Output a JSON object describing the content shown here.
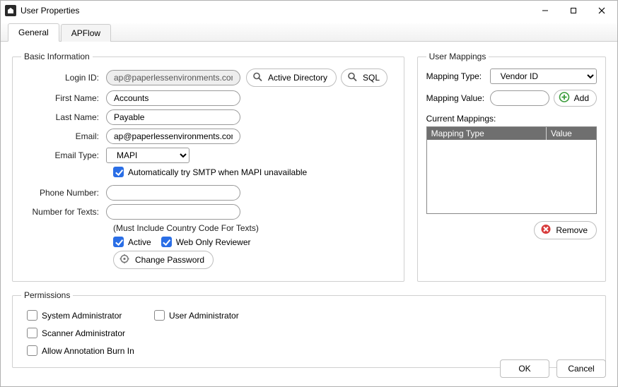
{
  "window": {
    "title": "User Properties"
  },
  "tabs": {
    "general": "General",
    "apflow": "APFlow"
  },
  "basic": {
    "legend": "Basic Information",
    "labels": {
      "login": "Login ID:",
      "first": "First Name:",
      "last": "Last Name:",
      "email": "Email:",
      "emailType": "Email Type:",
      "phone": "Phone Number:",
      "texts": "Number for Texts:"
    },
    "values": {
      "login": "ap@paperlessenvironments.com",
      "first": "Accounts",
      "last": "Payable",
      "email": "ap@paperlessenvironments.com",
      "emailType": "MAPI",
      "phone": "",
      "texts": ""
    },
    "buttons": {
      "ad": "Active Directory",
      "sql": "SQL",
      "change_pw": "Change Password"
    },
    "smtp_fallback": "Automatically try SMTP when MAPI unavailable",
    "texts_hint": "(Must Include Country Code For Texts)",
    "active": "Active",
    "web_only": "Web Only Reviewer"
  },
  "mappings": {
    "legend": "User Mappings",
    "type_label": "Mapping Type:",
    "type_value": "Vendor ID",
    "value_label": "Mapping Value:",
    "value_value": "",
    "add": "Add",
    "current_label": "Current Mappings:",
    "col_type": "Mapping Type",
    "col_value": "Value",
    "remove": "Remove"
  },
  "permissions": {
    "legend": "Permissions",
    "sys_admin": "System Administrator",
    "user_admin": "User Administrator",
    "scanner_admin": "Scanner Administrator",
    "burn_in": "Allow Annotation Burn In"
  },
  "footer": {
    "ok": "OK",
    "cancel": "Cancel"
  }
}
